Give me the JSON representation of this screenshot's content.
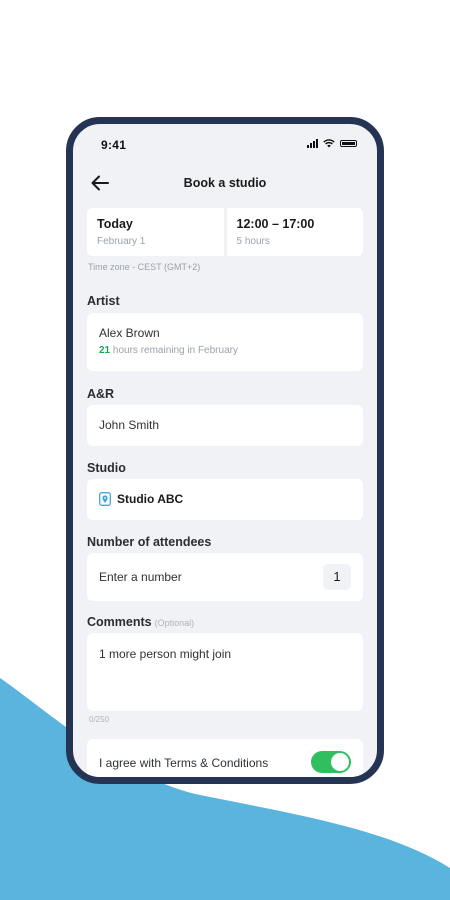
{
  "status_bar": {
    "time": "9:41"
  },
  "header": {
    "title": "Book a studio"
  },
  "booking": {
    "date_main": "Today",
    "date_sub": "February 1",
    "time_main": "12:00 – 17:00",
    "time_sub": "5 hours",
    "timezone": "Time zone - CEST (GMT+2)"
  },
  "artist": {
    "label": "Artist",
    "name": "Alex Brown",
    "hours_count": "21",
    "hours_text": " hours remaining in February"
  },
  "ar": {
    "label": "A&R",
    "name": "John Smith"
  },
  "studio": {
    "label": "Studio",
    "name": "Studio ABC"
  },
  "attendees": {
    "label": "Number of attendees",
    "placeholder": "Enter a number",
    "value": "1"
  },
  "comments": {
    "label": "Comments",
    "optional": "(Optional)",
    "value": "1 more person might join",
    "counter": "0/250"
  },
  "agree": {
    "text": "I agree with Terms & Conditions",
    "checked": true
  },
  "colors": {
    "accent_green": "#2fbf5f",
    "frame": "#253453",
    "wave": "#5bb4de"
  }
}
